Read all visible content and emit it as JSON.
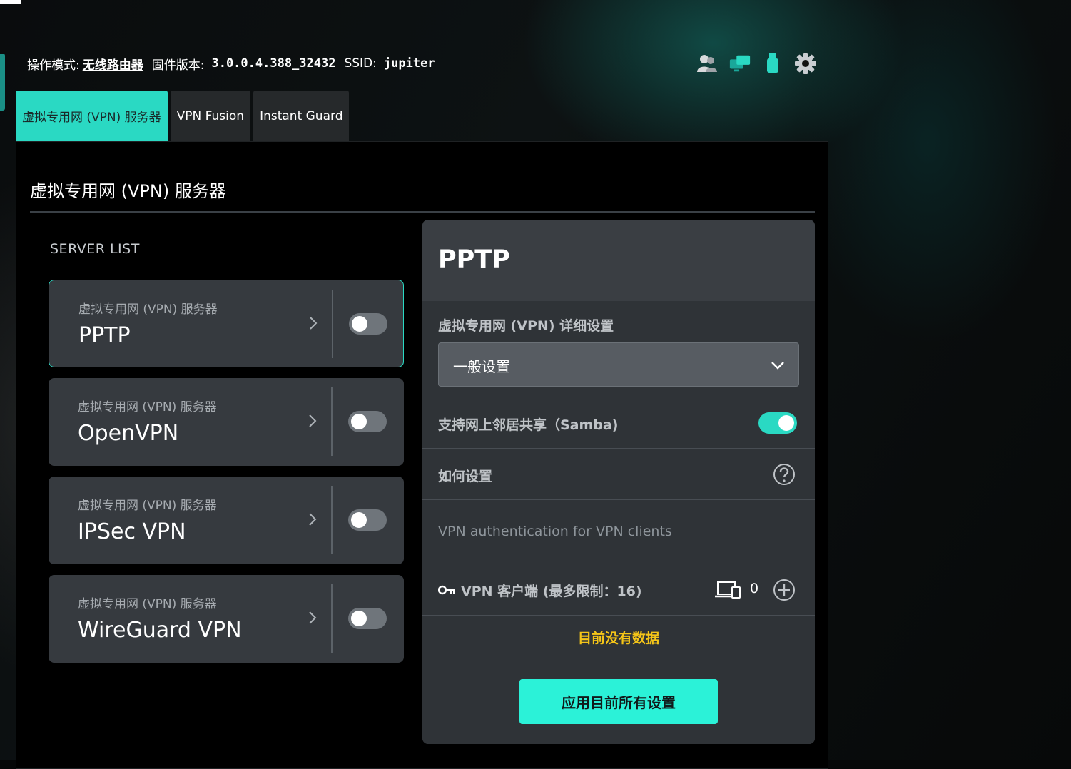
{
  "topbar": {
    "mode_label": "操作模式:",
    "mode_value": "无线路由器",
    "firmware_label": "固件版本:",
    "firmware_value": "3.0.0.4.388_32432",
    "ssid_label": "SSID:",
    "ssid_value": "jupiter",
    "icons": [
      "users-icon",
      "network-monitor-icon",
      "usb-icon",
      "settings-gear-icon"
    ]
  },
  "tabs": [
    {
      "label": "虚拟专用网 (VPN) 服务器",
      "active": true
    },
    {
      "label": "VPN Fusion",
      "active": false
    },
    {
      "label": "Instant Guard",
      "active": false
    }
  ],
  "page_title": "虚拟专用网 (VPN) 服务器",
  "server_list": {
    "label": "SERVER LIST",
    "items": [
      {
        "subtitle": "虚拟专用网 (VPN) 服务器",
        "name": "PPTP",
        "selected": true,
        "enabled": false
      },
      {
        "subtitle": "虚拟专用网 (VPN) 服务器",
        "name": "OpenVPN",
        "selected": false,
        "enabled": false
      },
      {
        "subtitle": "虚拟专用网 (VPN) 服务器",
        "name": "IPSec VPN",
        "selected": false,
        "enabled": false
      },
      {
        "subtitle": "虚拟专用网 (VPN) 服务器",
        "name": "WireGuard VPN",
        "selected": false,
        "enabled": false
      }
    ]
  },
  "detail": {
    "title": "PPTP",
    "settings_label": "虚拟专用网 (VPN) 详细设置",
    "settings_select_value": "一般设置",
    "samba_label": "支持网上邻居共享（Samba)",
    "samba_enabled": true,
    "howto_label": "如何设置",
    "auth_desc": "VPN authentication for VPN clients",
    "clients_label": "VPN 客户端 (最多限制：16)",
    "clients_count": "0",
    "no_data": "目前没有数据",
    "apply_button": "应用目前所有设置"
  },
  "colors": {
    "accent": "#2ad9c3",
    "apply_button": "#2bf2d8",
    "no_data": "#f5c518",
    "card": "#363a3f"
  }
}
